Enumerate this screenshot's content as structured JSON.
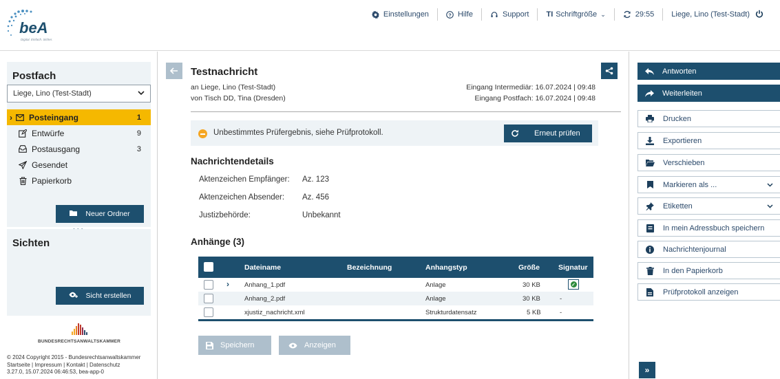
{
  "logo": {
    "text": "beA",
    "tagline": "Digital. Einfach. Sicher."
  },
  "topnav": {
    "settings": "Einstellungen",
    "help": "Hilfe",
    "support": "Support",
    "fontsize_icon": "TI",
    "fontsize": "Schriftgröße",
    "timer": "29:55",
    "user": "Liege, Lino (Test-Stadt)"
  },
  "sidebar": {
    "title": "Postfach",
    "mailbox": "Liege, Lino (Test-Stadt)",
    "folders": [
      {
        "label": "Posteingang",
        "count": "1",
        "icon": "envelope-icon"
      },
      {
        "label": "Entwürfe",
        "count": "9",
        "icon": "edit-icon"
      },
      {
        "label": "Postausgang",
        "count": "3",
        "icon": "outbox-icon"
      },
      {
        "label": "Gesendet",
        "count": "",
        "icon": "sent-icon"
      },
      {
        "label": "Papierkorb",
        "count": "",
        "icon": "trash-icon"
      }
    ],
    "new_folder": "Neuer Ordner",
    "more": "•••",
    "views_title": "Sichten",
    "create_view": "Sicht erstellen",
    "brak_name": "BUNDESRECHTSANWALTSKAMMER",
    "footer": {
      "copyright": "© 2024 Copyright 2015 - Bundesrechtsanwaltskammer",
      "links": "Startseite | Impressum | Kontakt | Datenschutz",
      "version": "3.27.0, 15.07.2024 06:46:53, bea-app-0"
    }
  },
  "message": {
    "title": "Testnachricht",
    "to": "an Liege, Lino (Test-Stadt)",
    "from": "von Tisch DD, Tina (Dresden)",
    "received_intermediary": "Eingang Intermediär: 16.07.2024 | 09:48",
    "received_mailbox": "Eingang Postfach: 16.07.2024 | 09:48",
    "check_result": "Unbestimmtes Prüfergebnis, siehe Prüfprotokoll.",
    "recheck": "Erneut prüfen",
    "details_title": "Nachrichtendetails",
    "details": [
      {
        "label": "Aktenzeichen Empfänger:",
        "value": "Az. 123"
      },
      {
        "label": "Aktenzeichen Absender:",
        "value": "Az. 456"
      },
      {
        "label": "Justizbehörde:",
        "value": "Unbekannt"
      }
    ],
    "attachments_title": "Anhänge (3)",
    "columns": {
      "filename": "Dateiname",
      "designation": "Bezeichnung",
      "type": "Anhangstyp",
      "size": "Größe",
      "signature": "Signatur"
    },
    "attachments": [
      {
        "filename": "Anhang_1.pdf",
        "designation": "",
        "type": "Anlage",
        "size": "30 KB",
        "signature": "valid"
      },
      {
        "filename": "Anhang_2.pdf",
        "designation": "",
        "type": "Anlage",
        "size": "30 KB",
        "signature": "-"
      },
      {
        "filename": "xjustiz_nachricht.xml",
        "designation": "",
        "type": "Strukturdatensatz",
        "size": "5 KB",
        "signature": "-"
      }
    ],
    "save": "Speichern",
    "view": "Anzeigen"
  },
  "actions": {
    "reply": "Antworten",
    "forward": "Weiterleiten",
    "print": "Drucken",
    "export": "Exportieren",
    "move": "Verschieben",
    "mark_as": "Markieren als ...",
    "labels": "Etiketten",
    "address_book": "In mein Adressbuch speichern",
    "journal": "Nachrichtenjournal",
    "trash": "In den Papierkorb",
    "protocol": "Prüfprotokoll anzeigen",
    "collapse": "»"
  },
  "colors": {
    "primary": "#1d4f6e",
    "active": "#f5b800",
    "panel": "#eef3f6",
    "disabled": "#aebfcc",
    "warning": "#f5a623",
    "valid": "#2e8b3d"
  }
}
